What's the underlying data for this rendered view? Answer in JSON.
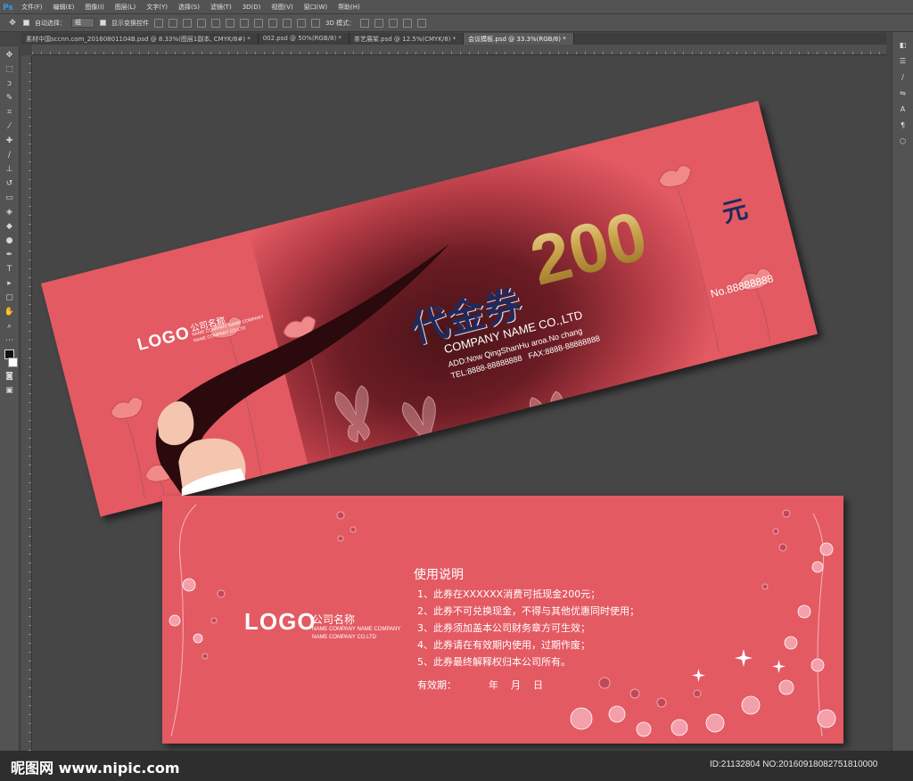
{
  "menu": {
    "app_icon": "Ps",
    "items": [
      "文件(F)",
      "编辑(E)",
      "图像(I)",
      "图层(L)",
      "文字(Y)",
      "选择(S)",
      "滤镜(T)",
      "3D(D)",
      "视图(V)",
      "窗口(W)",
      "帮助(H)"
    ]
  },
  "options": {
    "auto_select_label": "自动选择：",
    "auto_select_value": "组",
    "show_transform_label": "显示变换控件",
    "mode_3d_label": "3D 模式："
  },
  "tabs": [
    {
      "label": "素材中国sccnn.com_20160801104B.psd @ 8.33%(图层1副本, CMYK/8#) *",
      "active": false
    },
    {
      "label": "002.psd @ 50%(RGB/8) *",
      "active": false
    },
    {
      "label": "茶艺展架.psd @ 12.5%(CMYK/8) *",
      "active": false
    },
    {
      "label": "会议模板.psd @ 33.3%(RGB/8) *",
      "active": true
    }
  ],
  "voucher_front": {
    "logo": "LOGO",
    "company_cn": "公司名称",
    "company_en_1": "NAME COMPANY NAME COMPANY",
    "company_en_2": "NAME COMPANY CO.LTD",
    "title_cn": "代金券",
    "amount": "200",
    "unit": "元",
    "company_name": "COMPANY NAME CO.,LTD",
    "address": "ADD:Now QingShanHu aroa.No chang",
    "phone": "TEL:8888-88888888   FAX:8888-88888888",
    "serial": "No.88888888"
  },
  "voucher_back": {
    "logo": "LOGO",
    "company_cn": "公司名称",
    "company_en_1": "NAME COMPANY NAME COMPANY",
    "company_en_2": "NAME COMPANY CO.LTD",
    "heading": "使用说明",
    "rules": [
      "1、此券在XXXXXX消费可抵现金200元；",
      "2、此券不可兑换现金，不得与其他优惠同时使用；",
      "3、此券须加盖本公司财务章方可生效；",
      "4、此券请在有效期内使用，过期作废；",
      "5、此券最终解释权归本公司所有。"
    ],
    "validity_label": "有效期：",
    "validity_date": "年    月    日"
  },
  "watermark": {
    "left": "昵图网 www.nipic.com",
    "right": "ID:21132804 NO:20160918082751810000"
  },
  "colors": {
    "voucher_bg": "#e35a63",
    "gold": "#c9a24a",
    "navy": "#1f2a5c"
  }
}
